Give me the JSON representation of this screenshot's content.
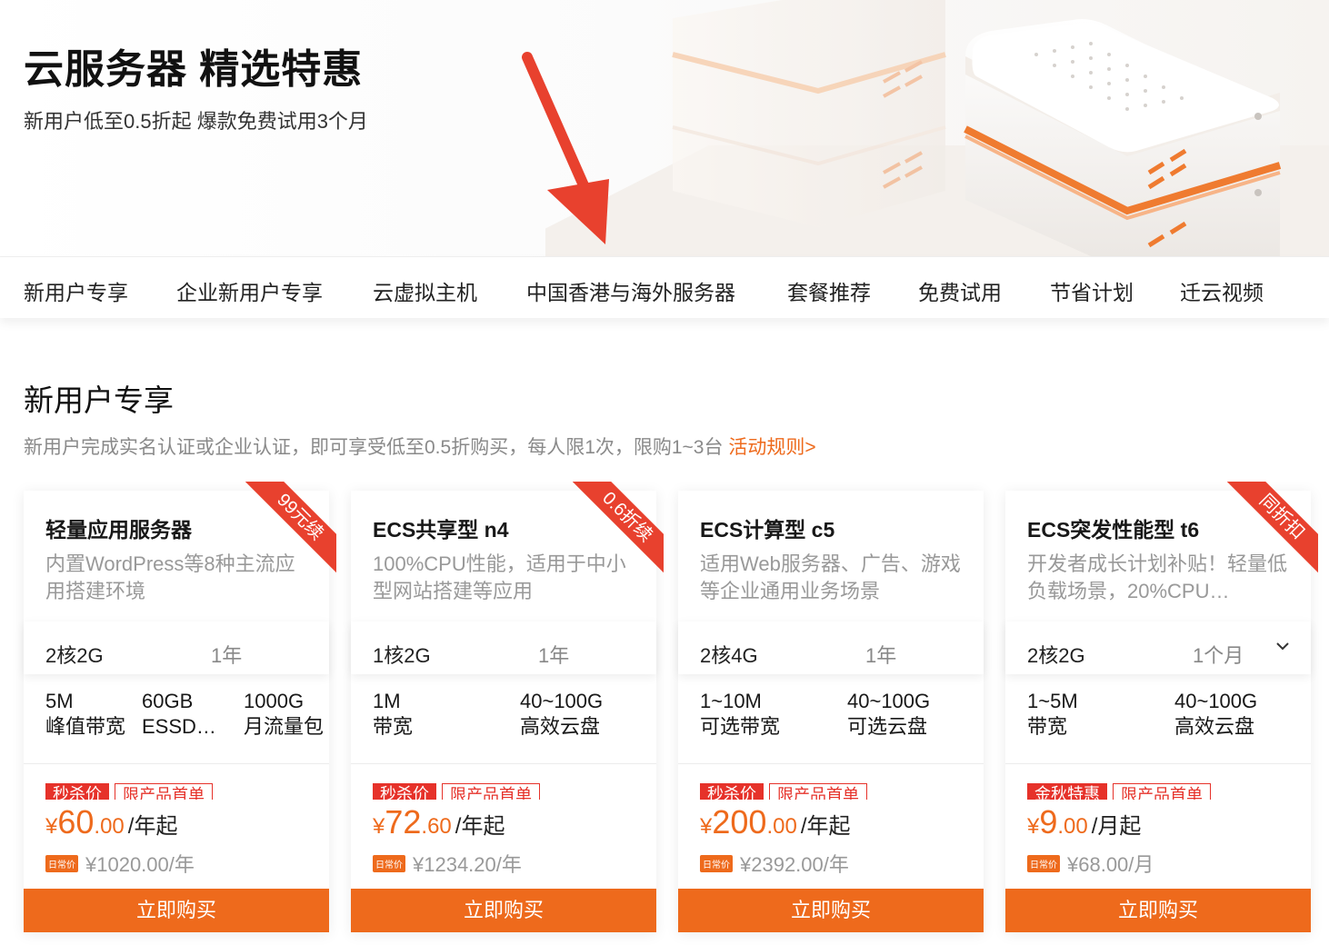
{
  "hero": {
    "title": "云服务器 精选特惠",
    "subtitle": "新用户低至0.5折起 爆款免费试用3个月"
  },
  "nav": {
    "items": [
      "新用户专享",
      "企业新用户专享",
      "云虚拟主机",
      "中国香港与海外服务器",
      "套餐推荐",
      "免费试用",
      "节省计划",
      "迁云视频"
    ]
  },
  "section": {
    "title": "新用户专享",
    "desc": "新用户完成实名认证或企业认证，即可享受低至0.5折购买，每人限1次，限购1~3台",
    "link": "活动规则>"
  },
  "cards": [
    {
      "ribbon": "99元续",
      "name": "轻量应用服务器",
      "desc": "内置WordPress等8种主流应用搭建环境",
      "spec_a": "2核2G",
      "spec_b": "1年",
      "features": [
        {
          "top": "5M",
          "bottom": "峰值带宽"
        },
        {
          "top": "60GB",
          "bottom": "ESSD…"
        },
        {
          "top": "1000G",
          "bottom": "月流量包"
        }
      ],
      "tags": [
        "秒杀价",
        "限产品首单"
      ],
      "currency": "¥",
      "price_int": "60",
      "price_dec": ".00",
      "price_unit": "/年起",
      "orig_badge": "日常价",
      "orig_price": "¥1020.00/年",
      "buy": "立即购买"
    },
    {
      "ribbon": "0.6折续",
      "name": "ECS共享型 n4",
      "desc": "100%CPU性能，适用于中小型网站搭建等应用",
      "spec_a": "1核2G",
      "spec_b": "1年",
      "features": [
        {
          "top": "1M",
          "bottom": "带宽"
        },
        {
          "top": "40~100G",
          "bottom": "高效云盘"
        }
      ],
      "tags": [
        "秒杀价",
        "限产品首单"
      ],
      "currency": "¥",
      "price_int": "72",
      "price_dec": ".60",
      "price_unit": "/年起",
      "orig_badge": "日常价",
      "orig_price": "¥1234.20/年",
      "buy": "立即购买"
    },
    {
      "name": "ECS计算型 c5",
      "desc": "适用Web服务器、广告、游戏等企业通用业务场景",
      "spec_a": "2核4G",
      "spec_b": "1年",
      "features": [
        {
          "top": "1~10M",
          "bottom": "可选带宽"
        },
        {
          "top": "40~100G",
          "bottom": "可选云盘"
        }
      ],
      "tags": [
        "秒杀价",
        "限产品首单"
      ],
      "currency": "¥",
      "price_int": "200",
      "price_dec": ".00",
      "price_unit": "/年起",
      "orig_badge": "日常价",
      "orig_price": "¥2392.00/年",
      "buy": "立即购买"
    },
    {
      "ribbon": "同折扣",
      "name": "ECS突发性能型 t6",
      "desc": "开发者成长计划补贴！轻量低负载场景，20%CPU…",
      "spec_a": "2核2G",
      "spec_b": "1个月",
      "features": [
        {
          "top": "1~5M",
          "bottom": "带宽"
        },
        {
          "top": "40~100G",
          "bottom": "高效云盘"
        }
      ],
      "tags": [
        "金秋特惠",
        "限产品首单"
      ],
      "currency": "¥",
      "price_int": "9",
      "price_dec": ".00",
      "price_unit": "/月起",
      "orig_badge": "日常价",
      "orig_price": "¥68.00/月",
      "buy": "立即购买"
    }
  ],
  "colors": {
    "accent": "#ee6a1c",
    "tag_red": "#e6322a",
    "arrow_red": "#e8412e"
  }
}
